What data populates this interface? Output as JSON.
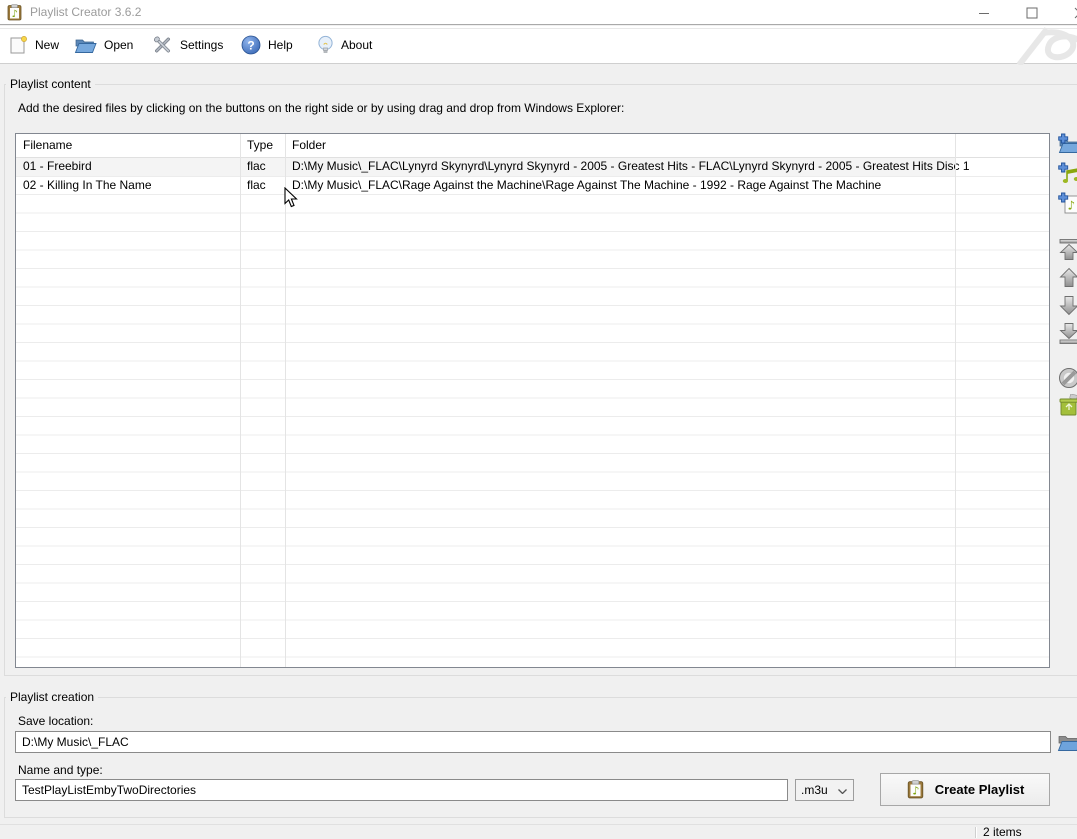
{
  "window": {
    "title": "Playlist Creator 3.6.2"
  },
  "toolbar": {
    "items": [
      {
        "label": "New",
        "icon": "new-file-icon"
      },
      {
        "label": "Open",
        "icon": "open-folder-icon"
      },
      {
        "label": "Settings",
        "icon": "settings-tools-icon"
      },
      {
        "label": "Help",
        "icon": "help-question-icon"
      },
      {
        "label": "About",
        "icon": "about-bulb-icon"
      }
    ]
  },
  "playlist_content": {
    "group_label": "Playlist content",
    "instruction": "Add the desired files by clicking on the buttons on the right side or by using drag and drop from Windows Explorer:",
    "table": {
      "columns": [
        "Filename",
        "Type",
        "Folder"
      ],
      "rows": [
        {
          "filename": "01 - Freebird",
          "type": "flac",
          "folder": "D:\\My Music\\_FLAC\\Lynyrd Skynyrd\\Lynyrd Skynyrd - 2005 - Greatest Hits - FLAC\\Lynyrd Skynyrd - 2005 - Greatest Hits Disc 1"
        },
        {
          "filename": "02 - Killing In The Name",
          "type": "flac",
          "folder": "D:\\My Music\\_FLAC\\Rage Against the Machine\\Rage Against The Machine - 1992 - Rage Against The Machine"
        }
      ]
    },
    "side_toolbar_icons": [
      "add-folder-icon",
      "add-tracks-icon",
      "add-file-icon",
      "move-top-icon",
      "move-up-icon",
      "move-down-icon",
      "move-bottom-icon",
      "remove-icon",
      "clear-list-icon"
    ]
  },
  "playlist_creation": {
    "group_label": "Playlist creation",
    "save_location_label": "Save location:",
    "save_location_value": "D:\\My Music\\_FLAC",
    "name_label": "Name and type:",
    "name_value": "TestPlayListEmbyTwoDirectories",
    "type_selected": ".m3u",
    "create_button_label": "Create Playlist"
  },
  "status_bar": {
    "items_count": "2 items"
  },
  "colors": {
    "accent_blue": "#6ea3dc",
    "note_green": "#8aa70d",
    "window_bg": "#f0f0f0"
  }
}
